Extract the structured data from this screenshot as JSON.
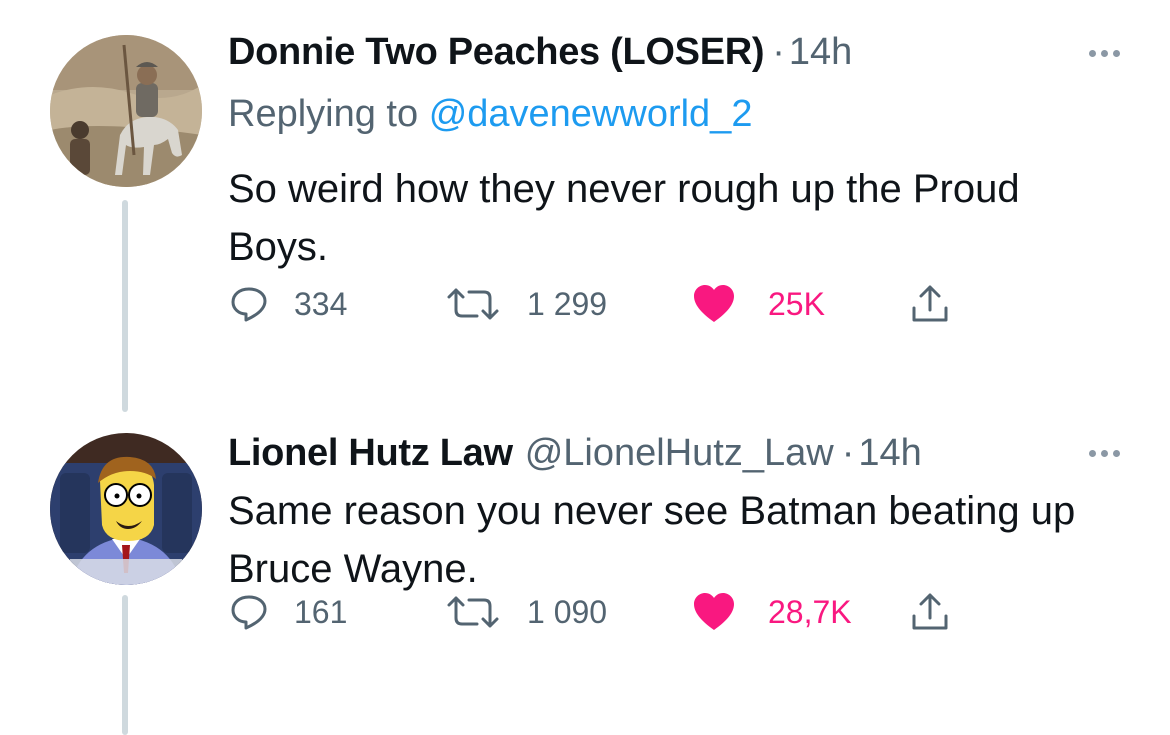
{
  "tweets": [
    {
      "display_name": "Donnie Two Peaches (LOSER)",
      "dot": "·",
      "time": "14h",
      "replying_prefix": "Replying to",
      "replying_to": "@davenewworld_2",
      "text": "So weird how they never rough up the Proud Boys.",
      "replies": "334",
      "retweets": "1 299",
      "likes": "25K",
      "avatar_icon": "knight-on-horse-avatar"
    },
    {
      "display_name": "Lionel Hutz Law",
      "handle": "@LionelHutz_Law",
      "dot": "·",
      "time": "14h",
      "text": "Same reason you never see Batman beating up Bruce Wayne.",
      "replies": "161",
      "retweets": "1 090",
      "likes": "28,7K",
      "avatar_icon": "cartoon-lawyer-avatar"
    }
  ],
  "colors": {
    "text": "#0f1419",
    "secondary": "#536471",
    "link": "#1d9bf0",
    "like": "#f91880",
    "thread_line": "#cfd9de"
  }
}
